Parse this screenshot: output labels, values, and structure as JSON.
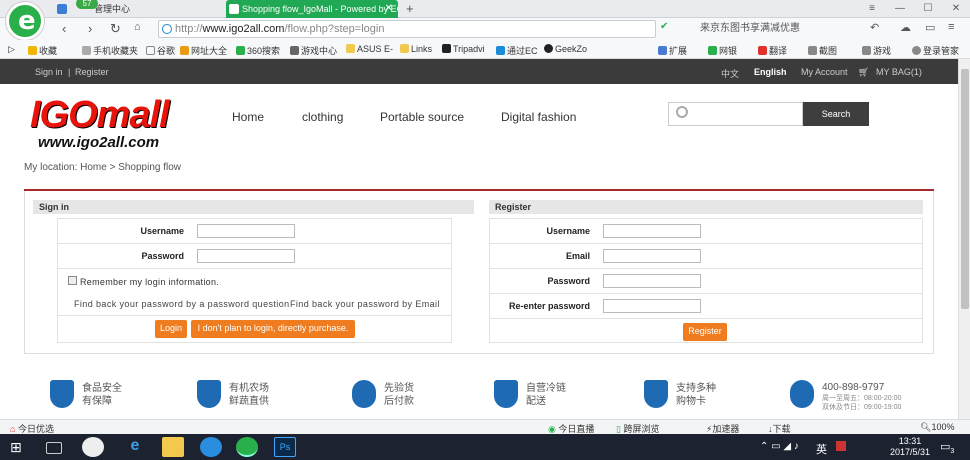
{
  "browser": {
    "tabs": [
      {
        "label": "管理中心"
      },
      {
        "label": "Shopping flow_IgoMall - Powered by ECShop"
      }
    ],
    "tab_badge": "57",
    "url_prefix": "http://",
    "url_domain": "www.igo2all.com",
    "url_path": "/flow.php?step=login",
    "search_hint": "来京东图书享满减优惠",
    "bookmarks": [
      "收藏",
      "手机收藏夹",
      "谷歌",
      "网址大全",
      "360搜索",
      "游戏中心",
      "ASUS E-",
      "Links",
      "Tripadvi",
      "通过EC",
      "GeekZo"
    ],
    "toolbar_items": [
      "扩展",
      "网银",
      "翻译",
      "截图",
      "游戏",
      "登录管家"
    ]
  },
  "site": {
    "top_left": {
      "signin": "Sign in",
      "separator": "|",
      "register": "Register"
    },
    "top_right": {
      "lang_cn": "中文",
      "lang_en": "English",
      "account": "My Account",
      "bag": "MY BAG(1)"
    },
    "brand_main": "IGOmall",
    "brand_url": "www.igo2all.com",
    "nav": [
      "Home",
      "clothing",
      "Portable source",
      "Digital fashion"
    ],
    "search_button": "Search",
    "breadcrumb": "My location: Home > Shopping flow"
  },
  "signin": {
    "title": "Sign in",
    "username_label": "Username",
    "password_label": "Password",
    "remember_label": "Remember my login information.",
    "find_by_question": "Find back your password by a password question",
    "find_by_email": "Find back your password by Email",
    "login_button": "Login",
    "guest_button": "I don't plan to login, directly purchase."
  },
  "register": {
    "title": "Register",
    "username_label": "Username",
    "email_label": "Email",
    "password_label": "Password",
    "reenter_label": "Re-enter password",
    "register_button": "Register"
  },
  "features": [
    {
      "line1": "食品安全",
      "line2": "有保障"
    },
    {
      "line1": "有机农场",
      "line2": "鲜蔬直供"
    },
    {
      "line1": "先验货",
      "line2": "后付款"
    },
    {
      "line1": "自营冷链",
      "line2": "配送"
    },
    {
      "line1": "支持多种",
      "line2": "购物卡"
    },
    {
      "line1": "400-898-9797",
      "line2": "周一至周五：08:00-20:00",
      "line3": "双休及节日：09:00-19:00"
    }
  ],
  "statusbar": {
    "left": "今日优选",
    "live": "今日直播",
    "cross": "跨屏浏览",
    "accel": "加速器",
    "download": "下载",
    "zoom": "100%"
  },
  "taskbar": {
    "time": "13:31",
    "date": "2017/5/31",
    "ime": "英",
    "notify_count": "3"
  },
  "colors": {
    "accent_green": "#21a854",
    "brand_red": "#e8140c",
    "button_orange": "#ef7d1f",
    "feature_blue": "#1e6bb4",
    "top_bar": "#3b3b3b"
  }
}
